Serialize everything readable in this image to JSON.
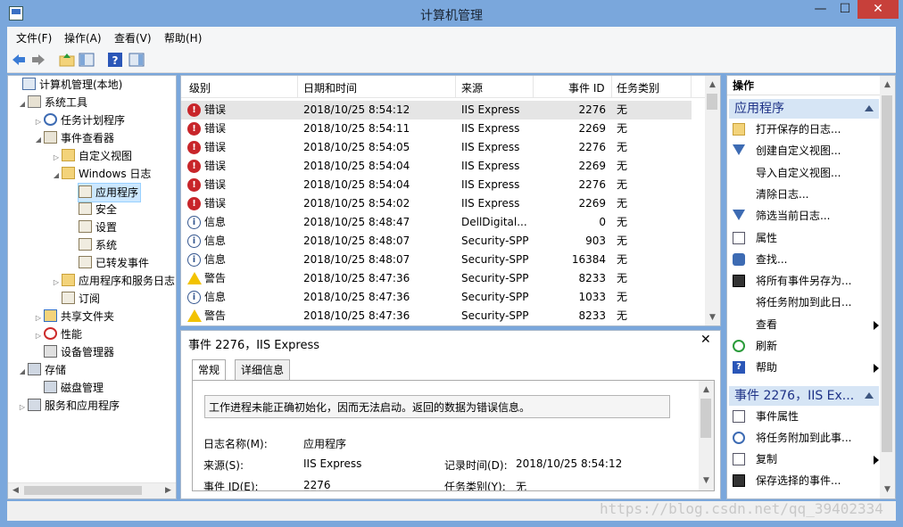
{
  "window": {
    "title": "计算机管理",
    "min": "—",
    "max": "☐",
    "close": "✕"
  },
  "menu": [
    "文件(F)",
    "操作(A)",
    "查看(V)",
    "帮助(H)"
  ],
  "tree": [
    {
      "label": "计算机管理(本地)",
      "icon": "computer-icon",
      "twisty": "",
      "depth": 0,
      "selected": false
    },
    {
      "label": "系统工具",
      "icon": "tools-icon",
      "twisty": "◢",
      "depth": 1,
      "selected": false
    },
    {
      "label": "任务计划程序",
      "icon": "clock-icon",
      "twisty": "▷",
      "depth": 2,
      "selected": false
    },
    {
      "label": "事件查看器",
      "icon": "event-viewer-icon",
      "twisty": "◢",
      "depth": 2,
      "selected": false
    },
    {
      "label": "自定义视图",
      "icon": "folder-icon",
      "twisty": "▷",
      "depth": 3,
      "selected": false
    },
    {
      "label": "Windows 日志",
      "icon": "folder-icon",
      "twisty": "◢",
      "depth": 3,
      "selected": false
    },
    {
      "label": "应用程序",
      "icon": "log-icon",
      "twisty": "",
      "depth": 4,
      "selected": true
    },
    {
      "label": "安全",
      "icon": "log-icon",
      "twisty": "",
      "depth": 4,
      "selected": false
    },
    {
      "label": "设置",
      "icon": "log-icon",
      "twisty": "",
      "depth": 4,
      "selected": false
    },
    {
      "label": "系统",
      "icon": "log-icon",
      "twisty": "",
      "depth": 4,
      "selected": false
    },
    {
      "label": "已转发事件",
      "icon": "log-icon",
      "twisty": "",
      "depth": 4,
      "selected": false
    },
    {
      "label": "应用程序和服务日志",
      "icon": "folder-icon",
      "twisty": "▷",
      "depth": 3,
      "selected": false
    },
    {
      "label": "订阅",
      "icon": "log-icon",
      "twisty": "",
      "depth": 3,
      "selected": false
    },
    {
      "label": "共享文件夹",
      "icon": "shared-folder-icon",
      "twisty": "▷",
      "depth": 2,
      "selected": false
    },
    {
      "label": "性能",
      "icon": "performance-icon",
      "twisty": "▷",
      "depth": 2,
      "selected": false
    },
    {
      "label": "设备管理器",
      "icon": "device-manager-icon",
      "twisty": "",
      "depth": 2,
      "selected": false
    },
    {
      "label": "存储",
      "icon": "storage-icon",
      "twisty": "◢",
      "depth": 1,
      "selected": false
    },
    {
      "label": "磁盘管理",
      "icon": "disk-icon",
      "twisty": "",
      "depth": 2,
      "selected": false
    },
    {
      "label": "服务和应用程序",
      "icon": "services-icon",
      "twisty": "▷",
      "depth": 1,
      "selected": false
    }
  ],
  "events": {
    "columns": [
      "级别",
      "日期和时间",
      "来源",
      "事件 ID",
      "任务类别"
    ],
    "rows": [
      {
        "level": "错误",
        "type": "error",
        "datetime": "2018/10/25 8:54:12",
        "source": "IIS Express",
        "id": "2276",
        "category": "无"
      },
      {
        "level": "错误",
        "type": "error",
        "datetime": "2018/10/25 8:54:11",
        "source": "IIS Express",
        "id": "2269",
        "category": "无"
      },
      {
        "level": "错误",
        "type": "error",
        "datetime": "2018/10/25 8:54:05",
        "source": "IIS Express",
        "id": "2276",
        "category": "无"
      },
      {
        "level": "错误",
        "type": "error",
        "datetime": "2018/10/25 8:54:04",
        "source": "IIS Express",
        "id": "2269",
        "category": "无"
      },
      {
        "level": "错误",
        "type": "error",
        "datetime": "2018/10/25 8:54:04",
        "source": "IIS Express",
        "id": "2276",
        "category": "无"
      },
      {
        "level": "错误",
        "type": "error",
        "datetime": "2018/10/25 8:54:02",
        "source": "IIS Express",
        "id": "2269",
        "category": "无"
      },
      {
        "level": "信息",
        "type": "info",
        "datetime": "2018/10/25 8:48:47",
        "source": "DellDigital...",
        "id": "0",
        "category": "无"
      },
      {
        "level": "信息",
        "type": "info",
        "datetime": "2018/10/25 8:48:07",
        "source": "Security-SPP",
        "id": "903",
        "category": "无"
      },
      {
        "level": "信息",
        "type": "info",
        "datetime": "2018/10/25 8:48:07",
        "source": "Security-SPP",
        "id": "16384",
        "category": "无"
      },
      {
        "level": "警告",
        "type": "warning",
        "datetime": "2018/10/25 8:47:36",
        "source": "Security-SPP",
        "id": "8233",
        "category": "无"
      },
      {
        "level": "信息",
        "type": "info",
        "datetime": "2018/10/25 8:47:36",
        "source": "Security-SPP",
        "id": "1033",
        "category": "无"
      },
      {
        "level": "警告",
        "type": "warning",
        "datetime": "2018/10/25 8:47:36",
        "source": "Security-SPP",
        "id": "8233",
        "category": "无"
      }
    ]
  },
  "detail": {
    "title": "事件 2276，IIS Express",
    "close": "✕",
    "tabs": [
      "常规",
      "详细信息"
    ],
    "message": "工作进程未能正确初始化，因而无法启动。返回的数据为错误信息。",
    "log_name_label": "日志名称(M):",
    "log_name": "应用程序",
    "source_label": "来源(S):",
    "source": "IIS Express",
    "logged_label": "记录时间(D):",
    "logged": "2018/10/25 8:54:12",
    "event_id_label": "事件 ID(E):",
    "event_id": "2276",
    "category_label": "任务类别(Y):",
    "category": "无"
  },
  "actions": {
    "header": "操作",
    "section1": "应用程序",
    "items1": [
      {
        "label": "打开保存的日志...",
        "icon": "open-log-icon",
        "submenu": false
      },
      {
        "label": "创建自定义视图...",
        "icon": "filter-icon",
        "submenu": false
      },
      {
        "label": "导入自定义视图...",
        "icon": "",
        "submenu": false
      },
      {
        "label": "清除日志...",
        "icon": "",
        "submenu": false
      },
      {
        "label": "筛选当前日志...",
        "icon": "filter-icon",
        "submenu": false
      },
      {
        "label": "属性",
        "icon": "properties-icon",
        "submenu": false
      },
      {
        "label": "查找...",
        "icon": "find-icon",
        "submenu": false
      },
      {
        "label": "将所有事件另存为...",
        "icon": "save-icon",
        "submenu": false
      },
      {
        "label": "将任务附加到此日...",
        "icon": "",
        "submenu": false
      },
      {
        "label": "查看",
        "icon": "",
        "submenu": true
      },
      {
        "label": "刷新",
        "icon": "refresh-icon",
        "submenu": false
      },
      {
        "label": "帮助",
        "icon": "help-icon",
        "submenu": true
      }
    ],
    "section2": "事件 2276，IIS Ex...",
    "items2": [
      {
        "label": "事件属性",
        "icon": "properties-icon",
        "submenu": false
      },
      {
        "label": "将任务附加到此事...",
        "icon": "task-icon",
        "submenu": false
      },
      {
        "label": "复制",
        "icon": "copy-icon",
        "submenu": true
      },
      {
        "label": "保存选择的事件...",
        "icon": "save-icon",
        "submenu": false
      }
    ]
  },
  "watermark": "https://blog.csdn.net/qq_39402334"
}
